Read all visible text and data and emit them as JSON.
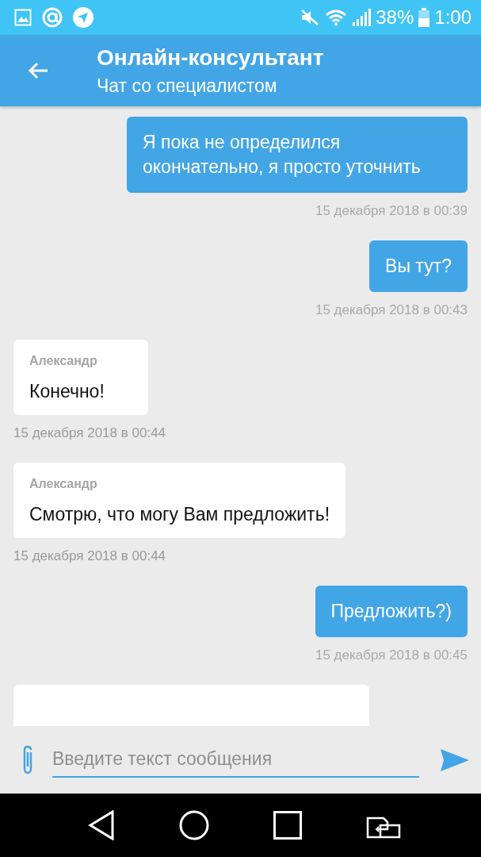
{
  "status_bar": {
    "battery": "38%",
    "time": "1:00"
  },
  "header": {
    "title": "Онлайн-консультант",
    "subtitle": "Чат со специалистом"
  },
  "messages": [
    {
      "kind": "outgoing",
      "text": "Я пока не определился окончательно, я просто уточнить",
      "time": "15 декабря 2018 в 00:39"
    },
    {
      "kind": "outgoing",
      "text": "Вы тут?",
      "time": "15 декабря 2018 в 00:43"
    },
    {
      "kind": "incoming",
      "sender": "Александр",
      "text": "Конечно!",
      "time": "15 декабря 2018 в 00:44"
    },
    {
      "kind": "incoming",
      "sender": "Александр",
      "text": "Смотрю, что могу Вам предложить!",
      "time": "15 декабря 2018 в 00:44"
    },
    {
      "kind": "outgoing",
      "text": "Предложить?)",
      "time": "15 декабря 2018 в 00:45"
    },
    {
      "kind": "incoming"
    }
  ],
  "composer": {
    "placeholder": "Введите текст сообщения"
  }
}
